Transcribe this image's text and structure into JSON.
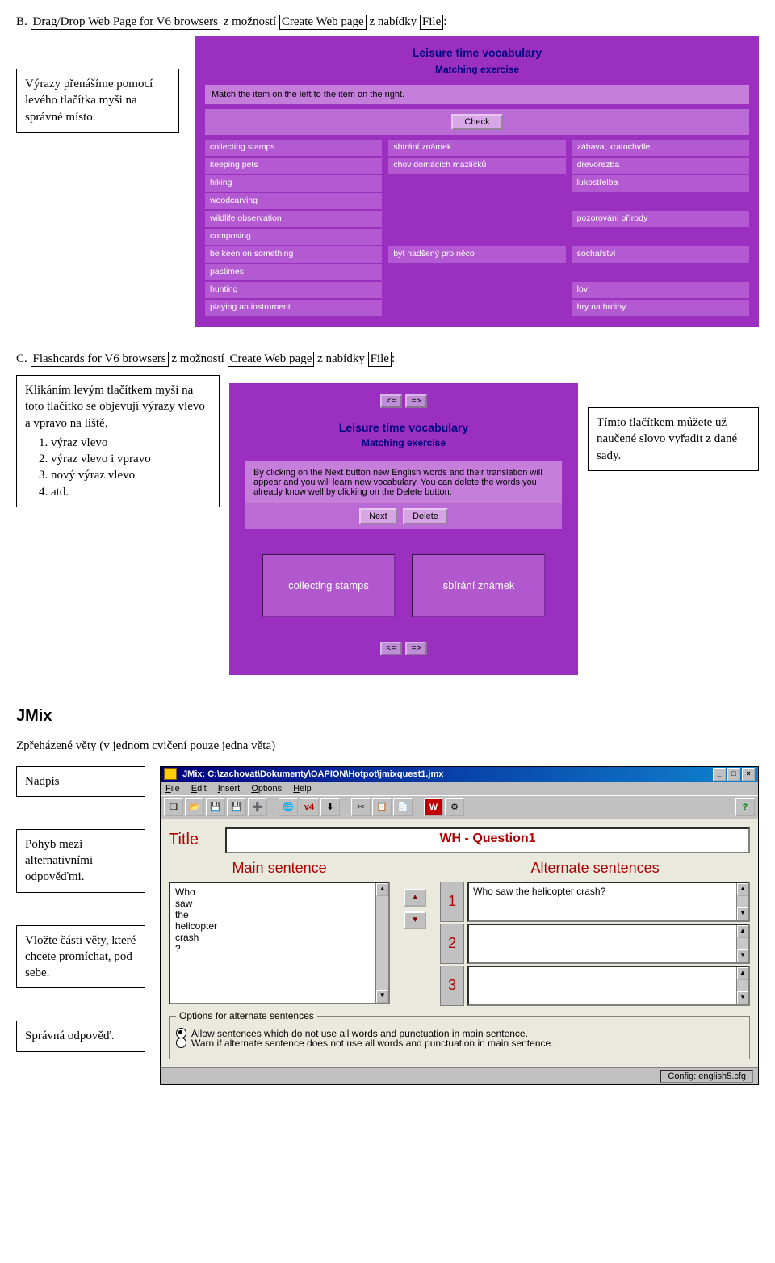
{
  "section_b": {
    "prefix": "B.",
    "box1": "Drag/Drop Web Page for V6 browsers",
    "mid": " z možností ",
    "box2": "Create Web page",
    "mid2": " z nabídky ",
    "box3": "File",
    "suffix": ":",
    "callout": "Výrazy přenášíme pomocí levého tlačítka myši na správné místo."
  },
  "shot1": {
    "title": "Leisure time vocabulary",
    "subtitle": "Matching exercise",
    "instruction": "Match the item on the left to the item on the right.",
    "check": "Check",
    "left_col": [
      "collecting stamps",
      "keeping pets",
      "hiking",
      "woodcarving",
      "wildlife observation",
      "composing",
      "be keen on something",
      "pastimes",
      "hunting",
      "playing an instrument"
    ],
    "mid_col": [
      "sbírání známek",
      "chov domácích mazlíčků",
      "",
      "",
      "",
      "",
      "být nadšený pro něco",
      "",
      "",
      ""
    ],
    "right_col": [
      "zábava, kratochvíle",
      "dřevořezba",
      "lukostřelba",
      "",
      "pozorování přírody",
      "",
      "sochařství",
      "",
      "lov",
      "hry na hrdiny"
    ]
  },
  "section_c": {
    "prefix": "C.",
    "box1": "Flashcards  for V6 browsers",
    "mid": " z možností ",
    "box2": "Create Web page",
    "mid2": " z nabídky ",
    "box3": "File",
    "suffix": ":",
    "callout_left_intro": "Klikáním levým tlačítkem myši na toto tlačítko se objevují výrazy vlevo a vpravo na liště.",
    "callout_left_items": [
      "výraz vlevo",
      "výraz vlevo i vpravo",
      "nový výraz vlevo",
      "atd."
    ],
    "callout_right": "Tímto tlačítkem můžete už naučené slovo vyřadit z dané sady."
  },
  "shot2": {
    "nav_prev": "<=",
    "nav_next": "=>",
    "title": "Leisure time vocabulary",
    "subtitle": "Matching exercise",
    "instruction": "By clicking on the Next button new English words and their translation will appear and you will learn new vocabulary. You can delete the words you already know well by clicking on the Delete button.",
    "next": "Next",
    "delete": "Delete",
    "card_left": "collecting stamps",
    "card_right": "sbírání známek"
  },
  "jmix": {
    "heading": "JMix",
    "desc": "Zpřeházené věty (v jednom  cvičení  pouze jedna věta)",
    "callout_nadpis": "Nadpis",
    "callout_pohyb": "Pohyb mezi alternativními odpověďmi.",
    "callout_vlozte": "Vložte části věty, které chcete promíchat,  pod sebe.",
    "callout_spravna": "Správná odpověď."
  },
  "win": {
    "title": "JMix: C:\\zachovat\\Dokumenty\\OAPION\\Hotpot\\jmixquest1.jmx",
    "menu": {
      "file": "File",
      "edit": "Edit",
      "insert": "Insert",
      "options": "Options",
      "help": "Help"
    },
    "title_label": "Title",
    "title_value": "WH - Question1",
    "main_label": "Main sentence",
    "alt_label": "Alternate sentences",
    "main_text": "Who\nsaw\nthe\nhelicopter\ncrash\n?",
    "alt1_num": "1",
    "alt1_text": "Who saw the helicopter crash?",
    "alt2_num": "2",
    "alt3_num": "3",
    "options_legend": "Options for alternate sentences",
    "radio1": "Allow sentences which do not use all words and punctuation in main sentence.",
    "radio2": "Warn if alternate sentence does not use all words and punctuation in main sentence.",
    "status": "Config: english5.cfg"
  },
  "icons": {
    "v4": "v4"
  }
}
